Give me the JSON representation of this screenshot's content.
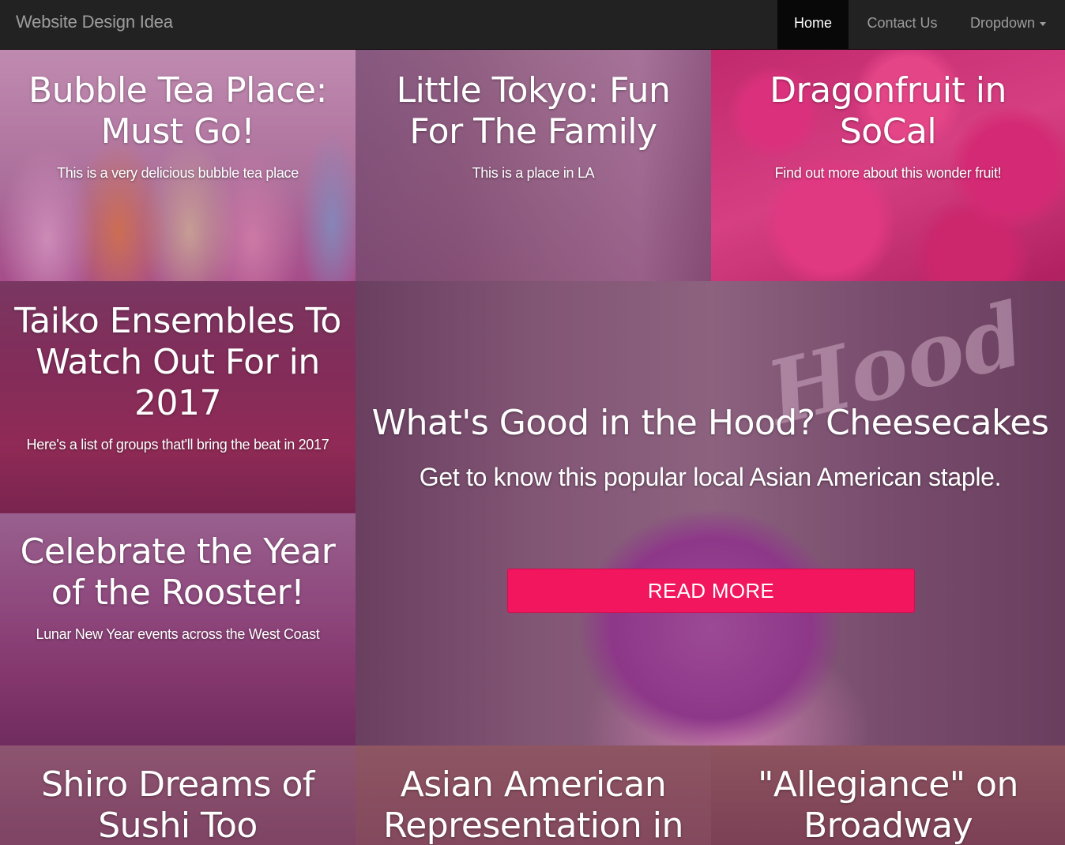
{
  "navbar": {
    "brand": "Website Design Idea",
    "items": [
      {
        "label": "Home",
        "active": true
      },
      {
        "label": "Contact Us",
        "active": false
      },
      {
        "label": "Dropdown",
        "active": false,
        "has_caret": true
      }
    ]
  },
  "tiles": {
    "bubble_tea": {
      "title": "Bubble Tea Place: Must Go!",
      "subtitle": "This is a very delicious bubble tea place"
    },
    "little_tokyo": {
      "title": "Little Tokyo: Fun For The Family",
      "subtitle": "This is a place in LA"
    },
    "dragonfruit": {
      "title": "Dragonfruit in SoCal",
      "subtitle": "Find out more about this wonder fruit!"
    },
    "taiko": {
      "title": "Taiko Ensembles To Watch Out For in 2017",
      "subtitle": "Here's a list of groups that'll bring the beat in 2017"
    },
    "rooster": {
      "title": "Celebrate the Year of the Rooster!",
      "subtitle": "Lunar New Year events across the West Coast"
    },
    "featured": {
      "title": "What's Good in the Hood? Cheesecakes",
      "subtitle": "Get to know this popular local Asian American staple.",
      "button": "READ MORE",
      "sign_text": "Hood"
    },
    "shiro": {
      "title": "Shiro Dreams of Sushi Too"
    },
    "representation": {
      "title": "Asian American Representation in"
    },
    "allegiance": {
      "title": "\"Allegiance\" on Broadway"
    }
  },
  "colors": {
    "navbar_bg": "#222222",
    "navbar_active_bg": "#080808",
    "nav_text": "#9d9d9d",
    "overlay": "rgba(150, 40, 110, 0.35)",
    "button_accent": "#f2165f"
  }
}
